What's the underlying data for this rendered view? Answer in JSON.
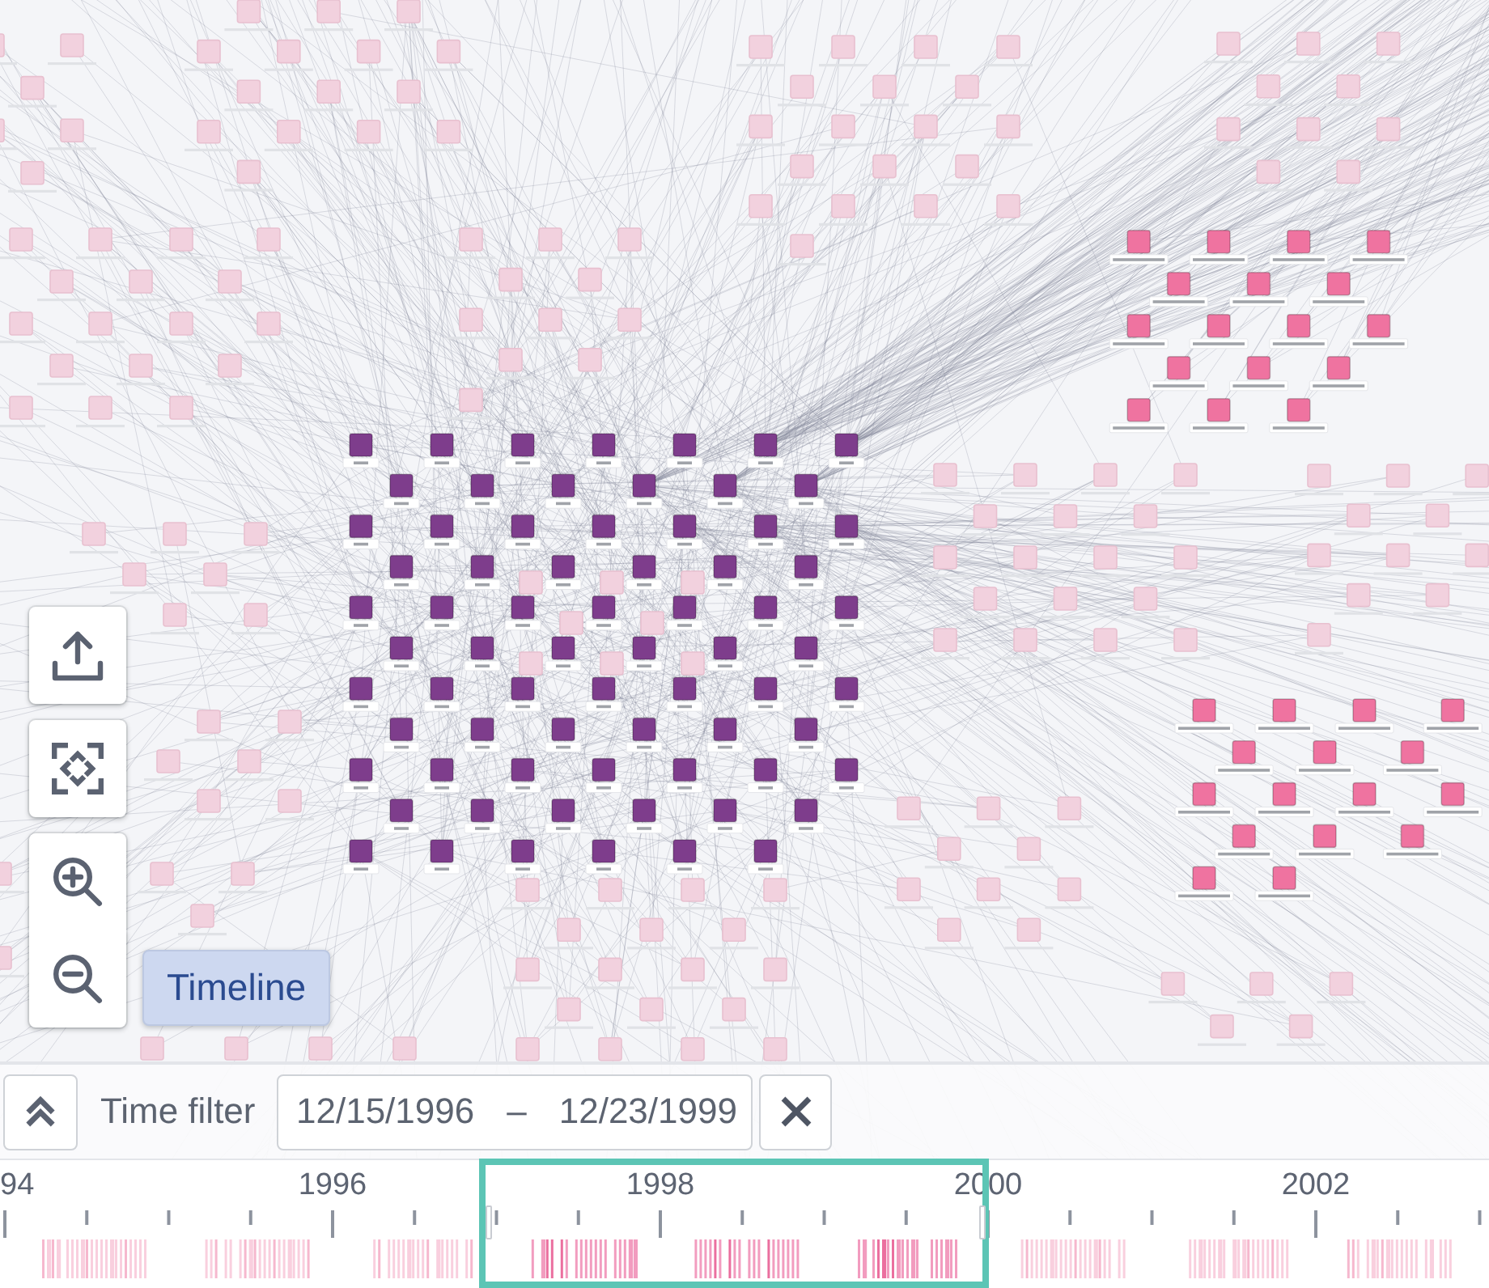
{
  "graph": {
    "clusters": [
      {
        "color": "#7e3d8c",
        "faded": false
      },
      {
        "color": "#ef73a0",
        "faded": false
      },
      {
        "color": "#ef73a0",
        "faded": false
      },
      {
        "color": "#f2d1de",
        "faded": true
      },
      {
        "color": "#f2d1de",
        "faded": true
      },
      {
        "color": "#f2d1de",
        "faded": true
      },
      {
        "color": "#f2d1de",
        "faded": true
      },
      {
        "color": "#f2d1de",
        "faded": true
      },
      {
        "color": "#f2d1de",
        "faded": true
      },
      {
        "color": "#f2d1de",
        "faded": true
      },
      {
        "color": "#f2d1de",
        "faded": true
      },
      {
        "color": "#f2d1de",
        "faded": true
      },
      {
        "color": "#f2d1de",
        "faded": true
      },
      {
        "color": "#f2d1de",
        "faded": true
      },
      {
        "color": "#f2d1de",
        "faded": true
      },
      {
        "color": "#f2d1de",
        "faded": true
      },
      {
        "color": "#f2d1de",
        "faded": true
      },
      {
        "color": "#f2d1de",
        "faded": true
      },
      {
        "color": "#f2d1de",
        "faded": true
      }
    ]
  },
  "view_controls": {
    "timeline_button": {
      "label": "Timeline",
      "on": true
    }
  },
  "time_filter": {
    "label": "Time filter",
    "start": "12/15/1996",
    "separator": "–",
    "end": "12/23/1999"
  },
  "timeline": {
    "axis_labels": [
      "94",
      "1996",
      "1998",
      "2000",
      "2002"
    ]
  }
}
